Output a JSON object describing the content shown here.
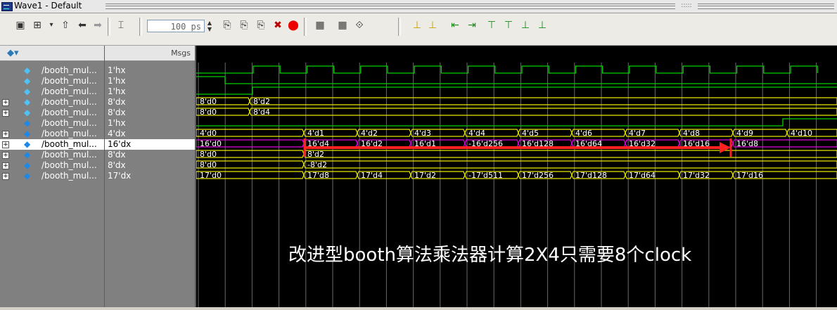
{
  "window": {
    "title": "Wave1 - Default",
    "grip_dots": ":::::"
  },
  "toolbar": {
    "zoom_value": "100 ps",
    "icons": [
      "window-icon",
      "tree-icon",
      "up-arrow-icon",
      "back-arrow-icon",
      "forward-arrow-icon",
      "insert-cursor-icon",
      "zoom-field",
      "run-icon",
      "continue-icon",
      "step-icon",
      "break-icon",
      "stop-icon",
      "restart-icon",
      "wave-options-icon",
      "find-icon",
      "edge-first-icon",
      "edge-last-icon",
      "edge-prev-icon",
      "edge-next-icon",
      "edge-rise-icon",
      "edge-fall-icon",
      "edge-any-icon",
      "edge-both-icon"
    ]
  },
  "header": {
    "msgs_label": "Msgs"
  },
  "signals": [
    {
      "name": "/booth_mul...",
      "value": "1'hx",
      "expandable": false
    },
    {
      "name": "/booth_mul...",
      "value": "1'hx",
      "expandable": false
    },
    {
      "name": "/booth_mul...",
      "value": "1'hx",
      "expandable": false
    },
    {
      "name": "/booth_mul...",
      "value": "8'dx",
      "expandable": true
    },
    {
      "name": "/booth_mul...",
      "value": "8'dx",
      "expandable": true
    },
    {
      "name": "/booth_mul...",
      "value": "1'hx",
      "expandable": false
    },
    {
      "name": "/booth_mul...",
      "value": "4'dx",
      "expandable": true
    },
    {
      "name": "/booth_mul...",
      "value": "16'dx",
      "expandable": true,
      "selected": true
    },
    {
      "name": "/booth_mul...",
      "value": "8'dx",
      "expandable": true
    },
    {
      "name": "/booth_mul...",
      "value": "8'dx",
      "expandable": true
    },
    {
      "name": "/booth_mul...",
      "value": "17'dx",
      "expandable": true
    }
  ],
  "waves": {
    "bus_row3": {
      "labels": [
        "8'd0",
        "8'd2"
      ]
    },
    "bus_row4": {
      "labels": [
        "8'd0",
        "8'd4"
      ]
    },
    "bus_row6": {
      "labels": [
        "4'd0",
        "4'd1",
        "4'd2",
        "4'd3",
        "4'd4",
        "4'd5",
        "4'd6",
        "4'd7",
        "4'd8",
        "4'd9",
        "4'd10"
      ]
    },
    "bus_row7": {
      "labels": [
        "16'd0",
        "16'd4",
        "16'd2",
        "16'd1",
        "-16'd256",
        "16'd128",
        "16'd64",
        "16'd32",
        "16'd16",
        "16'd8"
      ]
    },
    "bus_row8": {
      "labels": [
        "8'd0",
        "8'd2"
      ]
    },
    "bus_row9": {
      "labels": [
        "8'd0",
        "-8'd2"
      ]
    },
    "bus_row10": {
      "labels": [
        "17'd0",
        "17'd8",
        "17'd4",
        "17'd2",
        "-17'd511",
        "17'd256",
        "17'd128",
        "17'd64",
        "17'd32",
        "17'd16"
      ]
    }
  },
  "annotation": {
    "text": "改进型booth算法乘法器计算2X4只需要8个clock",
    "arrow_color": "#ff2020"
  },
  "colors": {
    "wave_green": "#00d000",
    "bus_yellow": "#e8e800",
    "bus_magenta": "#e000e0",
    "grid": "#6a6a6a"
  }
}
